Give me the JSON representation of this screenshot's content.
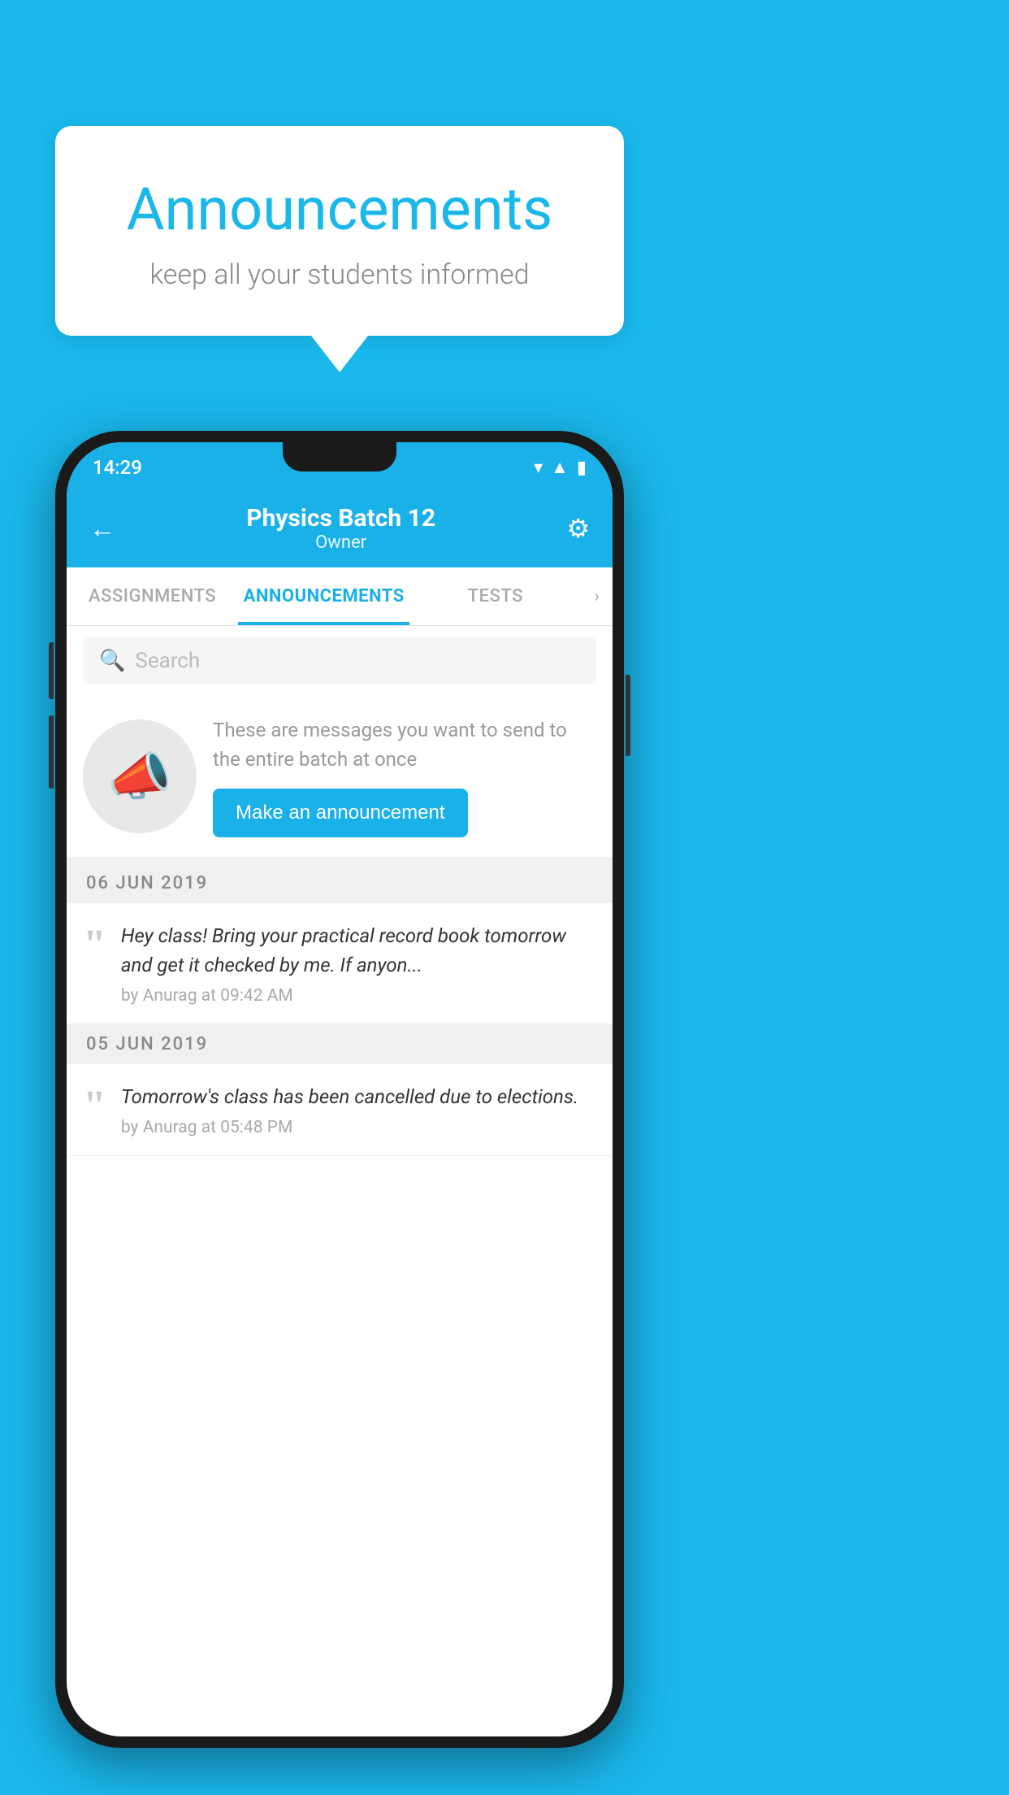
{
  "background_color": "#1ab7ea",
  "speech_bubble": {
    "title": "Announcements",
    "subtitle": "keep all your students informed"
  },
  "phone": {
    "status_bar": {
      "time": "14:29",
      "icons": [
        "wifi",
        "signal",
        "battery"
      ]
    },
    "header": {
      "back_label": "←",
      "title": "Physics Batch 12",
      "subtitle": "Owner",
      "gear_label": "⚙"
    },
    "tabs": [
      {
        "label": "ASSIGNMENTS",
        "active": false
      },
      {
        "label": "ANNOUNCEMENTS",
        "active": true
      },
      {
        "label": "TESTS",
        "active": false
      }
    ],
    "search": {
      "placeholder": "Search"
    },
    "promo": {
      "description": "These are messages you want to send to the entire batch at once",
      "button_label": "Make an announcement"
    },
    "announcements": [
      {
        "date": "06  JUN  2019",
        "items": [
          {
            "text": "Hey class! Bring your practical record book tomorrow and get it checked by me. If anyon...",
            "author": "by Anurag at 09:42 AM"
          }
        ]
      },
      {
        "date": "05  JUN  2019",
        "items": [
          {
            "text": "Tomorrow's class has been cancelled due to elections.",
            "author": "by Anurag at 05:48 PM"
          }
        ]
      }
    ]
  }
}
